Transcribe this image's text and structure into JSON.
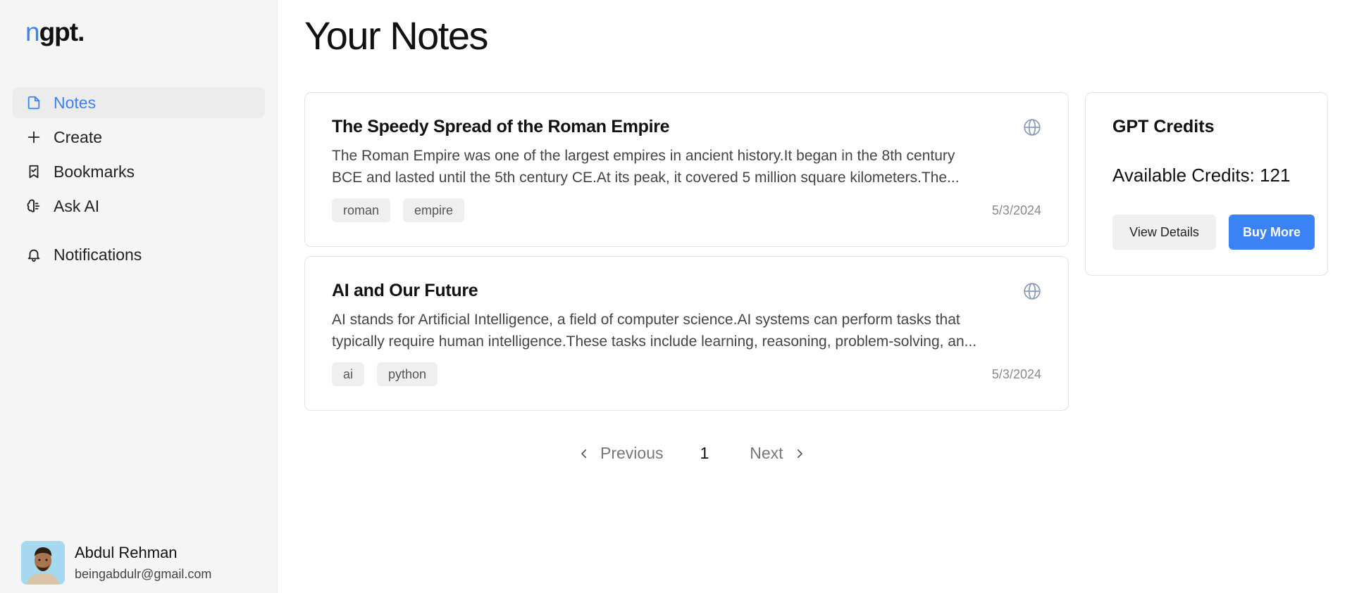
{
  "logo": {
    "first": "n",
    "rest": "gpt."
  },
  "sidebar": {
    "items": [
      {
        "label": "Notes",
        "icon": "file-icon",
        "active": true
      },
      {
        "label": "Create",
        "icon": "plus-icon"
      },
      {
        "label": "Bookmarks",
        "icon": "bookmark-icon"
      },
      {
        "label": "Ask AI",
        "icon": "brain-icon"
      },
      {
        "label": "Notifications",
        "icon": "bell-icon"
      }
    ]
  },
  "user": {
    "name": "Abdul Rehman",
    "email": "beingabdulr@gmail.com"
  },
  "main": {
    "title": "Your Notes",
    "notes": [
      {
        "title": "The Speedy Spread of the Roman Empire",
        "body_line1": "The Roman Empire was one of the largest empires in ancient history.It began in the 8th century",
        "body_line2": "BCE and lasted until the 5th century CE.At its peak, it covered 5 million square kilometers.The...",
        "tags": [
          "roman",
          "empire"
        ],
        "date": "5/3/2024"
      },
      {
        "title": "AI and Our Future",
        "body_line1": "AI stands for Artificial Intelligence, a field of computer science.AI systems can perform tasks that",
        "body_line2": "typically require human intelligence.These tasks include learning, reasoning, problem-solving, an...",
        "tags": [
          "ai",
          "python"
        ],
        "date": "5/3/2024"
      }
    ],
    "pagination": {
      "previous": "Previous",
      "page": "1",
      "next": "Next"
    }
  },
  "credits": {
    "title": "GPT Credits",
    "available": "Available Credits: 121",
    "view_details": "View Details",
    "buy_more": "Buy More"
  },
  "colors": {
    "accent": "#3b82f6",
    "sidebar_bg": "#f5f5f5"
  }
}
